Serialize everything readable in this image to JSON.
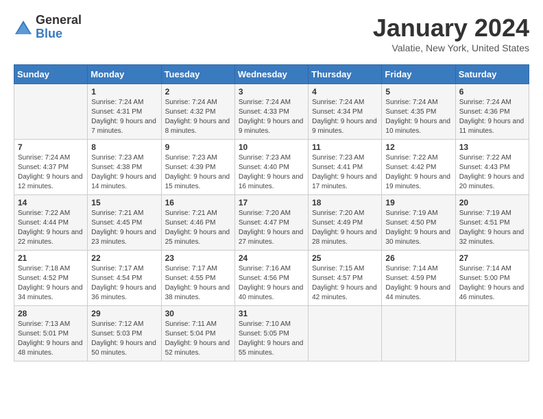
{
  "logo": {
    "general": "General",
    "blue": "Blue"
  },
  "header": {
    "month": "January 2024",
    "location": "Valatie, New York, United States"
  },
  "weekdays": [
    "Sunday",
    "Monday",
    "Tuesday",
    "Wednesday",
    "Thursday",
    "Friday",
    "Saturday"
  ],
  "weeks": [
    [
      {
        "day": "",
        "sunrise": "",
        "sunset": "",
        "daylight": ""
      },
      {
        "day": "1",
        "sunrise": "Sunrise: 7:24 AM",
        "sunset": "Sunset: 4:31 PM",
        "daylight": "Daylight: 9 hours and 7 minutes."
      },
      {
        "day": "2",
        "sunrise": "Sunrise: 7:24 AM",
        "sunset": "Sunset: 4:32 PM",
        "daylight": "Daylight: 9 hours and 8 minutes."
      },
      {
        "day": "3",
        "sunrise": "Sunrise: 7:24 AM",
        "sunset": "Sunset: 4:33 PM",
        "daylight": "Daylight: 9 hours and 9 minutes."
      },
      {
        "day": "4",
        "sunrise": "Sunrise: 7:24 AM",
        "sunset": "Sunset: 4:34 PM",
        "daylight": "Daylight: 9 hours and 9 minutes."
      },
      {
        "day": "5",
        "sunrise": "Sunrise: 7:24 AM",
        "sunset": "Sunset: 4:35 PM",
        "daylight": "Daylight: 9 hours and 10 minutes."
      },
      {
        "day": "6",
        "sunrise": "Sunrise: 7:24 AM",
        "sunset": "Sunset: 4:36 PM",
        "daylight": "Daylight: 9 hours and 11 minutes."
      }
    ],
    [
      {
        "day": "7",
        "sunrise": "Sunrise: 7:24 AM",
        "sunset": "Sunset: 4:37 PM",
        "daylight": "Daylight: 9 hours and 12 minutes."
      },
      {
        "day": "8",
        "sunrise": "Sunrise: 7:23 AM",
        "sunset": "Sunset: 4:38 PM",
        "daylight": "Daylight: 9 hours and 14 minutes."
      },
      {
        "day": "9",
        "sunrise": "Sunrise: 7:23 AM",
        "sunset": "Sunset: 4:39 PM",
        "daylight": "Daylight: 9 hours and 15 minutes."
      },
      {
        "day": "10",
        "sunrise": "Sunrise: 7:23 AM",
        "sunset": "Sunset: 4:40 PM",
        "daylight": "Daylight: 9 hours and 16 minutes."
      },
      {
        "day": "11",
        "sunrise": "Sunrise: 7:23 AM",
        "sunset": "Sunset: 4:41 PM",
        "daylight": "Daylight: 9 hours and 17 minutes."
      },
      {
        "day": "12",
        "sunrise": "Sunrise: 7:22 AM",
        "sunset": "Sunset: 4:42 PM",
        "daylight": "Daylight: 9 hours and 19 minutes."
      },
      {
        "day": "13",
        "sunrise": "Sunrise: 7:22 AM",
        "sunset": "Sunset: 4:43 PM",
        "daylight": "Daylight: 9 hours and 20 minutes."
      }
    ],
    [
      {
        "day": "14",
        "sunrise": "Sunrise: 7:22 AM",
        "sunset": "Sunset: 4:44 PM",
        "daylight": "Daylight: 9 hours and 22 minutes."
      },
      {
        "day": "15",
        "sunrise": "Sunrise: 7:21 AM",
        "sunset": "Sunset: 4:45 PM",
        "daylight": "Daylight: 9 hours and 23 minutes."
      },
      {
        "day": "16",
        "sunrise": "Sunrise: 7:21 AM",
        "sunset": "Sunset: 4:46 PM",
        "daylight": "Daylight: 9 hours and 25 minutes."
      },
      {
        "day": "17",
        "sunrise": "Sunrise: 7:20 AM",
        "sunset": "Sunset: 4:47 PM",
        "daylight": "Daylight: 9 hours and 27 minutes."
      },
      {
        "day": "18",
        "sunrise": "Sunrise: 7:20 AM",
        "sunset": "Sunset: 4:49 PM",
        "daylight": "Daylight: 9 hours and 28 minutes."
      },
      {
        "day": "19",
        "sunrise": "Sunrise: 7:19 AM",
        "sunset": "Sunset: 4:50 PM",
        "daylight": "Daylight: 9 hours and 30 minutes."
      },
      {
        "day": "20",
        "sunrise": "Sunrise: 7:19 AM",
        "sunset": "Sunset: 4:51 PM",
        "daylight": "Daylight: 9 hours and 32 minutes."
      }
    ],
    [
      {
        "day": "21",
        "sunrise": "Sunrise: 7:18 AM",
        "sunset": "Sunset: 4:52 PM",
        "daylight": "Daylight: 9 hours and 34 minutes."
      },
      {
        "day": "22",
        "sunrise": "Sunrise: 7:17 AM",
        "sunset": "Sunset: 4:54 PM",
        "daylight": "Daylight: 9 hours and 36 minutes."
      },
      {
        "day": "23",
        "sunrise": "Sunrise: 7:17 AM",
        "sunset": "Sunset: 4:55 PM",
        "daylight": "Daylight: 9 hours and 38 minutes."
      },
      {
        "day": "24",
        "sunrise": "Sunrise: 7:16 AM",
        "sunset": "Sunset: 4:56 PM",
        "daylight": "Daylight: 9 hours and 40 minutes."
      },
      {
        "day": "25",
        "sunrise": "Sunrise: 7:15 AM",
        "sunset": "Sunset: 4:57 PM",
        "daylight": "Daylight: 9 hours and 42 minutes."
      },
      {
        "day": "26",
        "sunrise": "Sunrise: 7:14 AM",
        "sunset": "Sunset: 4:59 PM",
        "daylight": "Daylight: 9 hours and 44 minutes."
      },
      {
        "day": "27",
        "sunrise": "Sunrise: 7:14 AM",
        "sunset": "Sunset: 5:00 PM",
        "daylight": "Daylight: 9 hours and 46 minutes."
      }
    ],
    [
      {
        "day": "28",
        "sunrise": "Sunrise: 7:13 AM",
        "sunset": "Sunset: 5:01 PM",
        "daylight": "Daylight: 9 hours and 48 minutes."
      },
      {
        "day": "29",
        "sunrise": "Sunrise: 7:12 AM",
        "sunset": "Sunset: 5:03 PM",
        "daylight": "Daylight: 9 hours and 50 minutes."
      },
      {
        "day": "30",
        "sunrise": "Sunrise: 7:11 AM",
        "sunset": "Sunset: 5:04 PM",
        "daylight": "Daylight: 9 hours and 52 minutes."
      },
      {
        "day": "31",
        "sunrise": "Sunrise: 7:10 AM",
        "sunset": "Sunset: 5:05 PM",
        "daylight": "Daylight: 9 hours and 55 minutes."
      },
      {
        "day": "",
        "sunrise": "",
        "sunset": "",
        "daylight": ""
      },
      {
        "day": "",
        "sunrise": "",
        "sunset": "",
        "daylight": ""
      },
      {
        "day": "",
        "sunrise": "",
        "sunset": "",
        "daylight": ""
      }
    ]
  ]
}
